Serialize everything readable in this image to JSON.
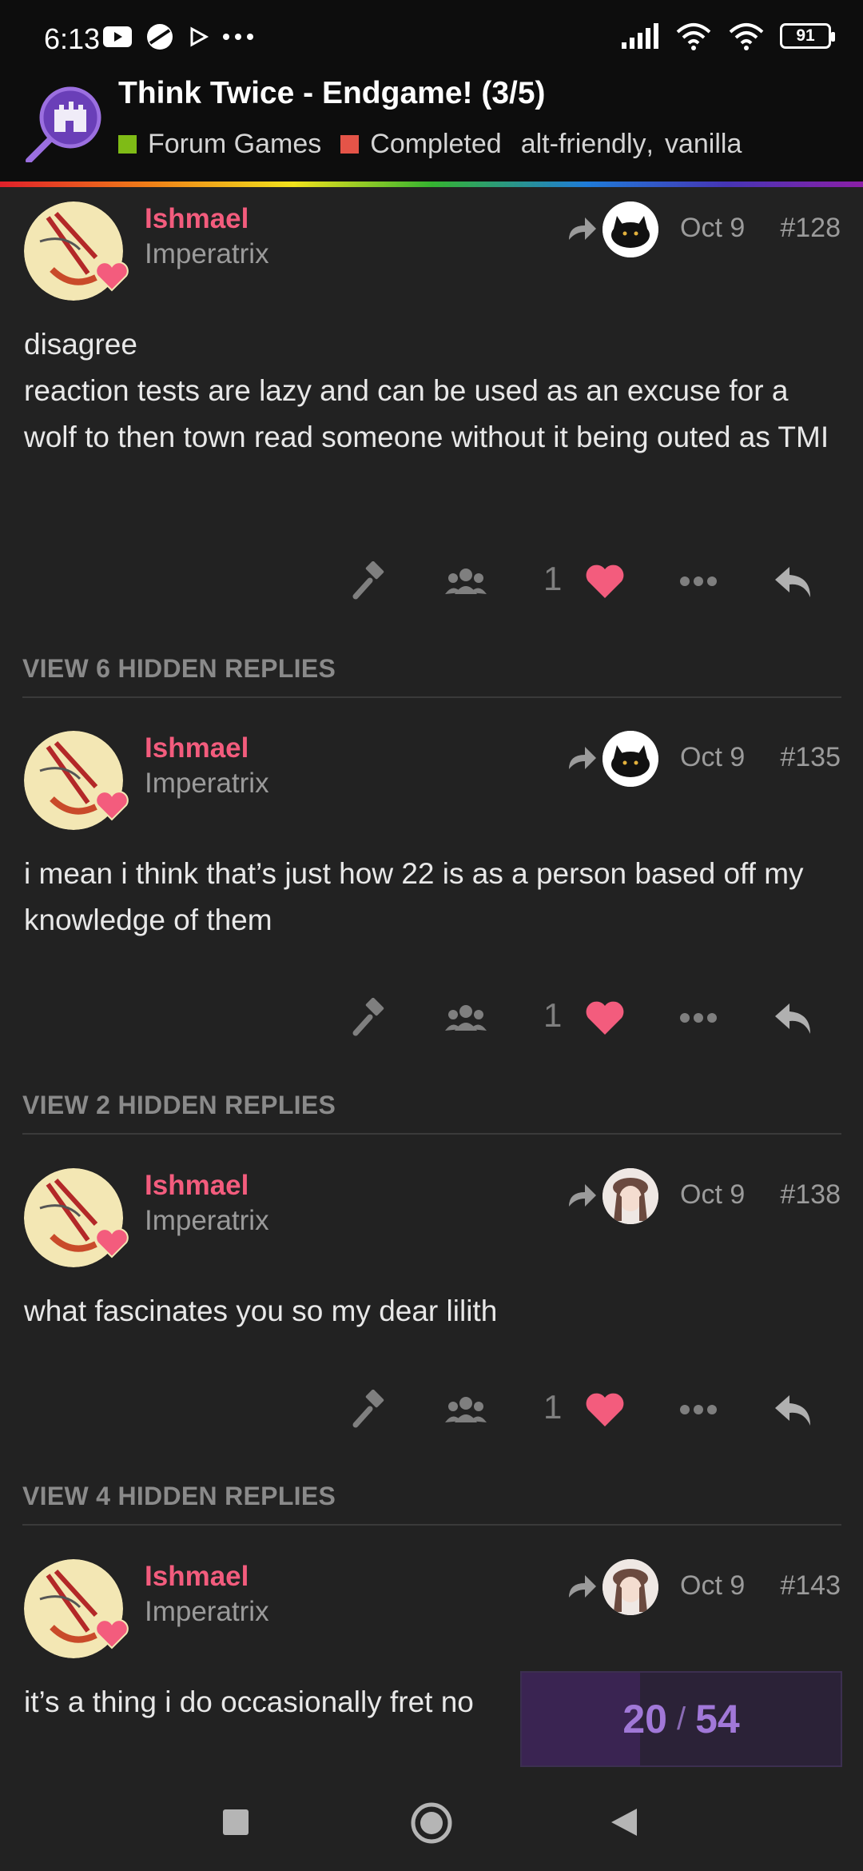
{
  "status_bar": {
    "time": "6:13",
    "battery": "91",
    "icons": [
      "youtube-icon",
      "app-icon",
      "play-store-icon",
      "more-dots-icon",
      "signal-icon",
      "wifi-icon",
      "wifi-2-icon",
      "battery-icon"
    ]
  },
  "topic": {
    "title": "Think Twice - Endgame! (3/5)",
    "category": {
      "name": "Forum Games",
      "color": "#7fbb16"
    },
    "status": {
      "name": "Completed",
      "color": "#e45448"
    },
    "tags": [
      "alt-friendly",
      "vanilla"
    ],
    "tag_separator": ","
  },
  "posts": [
    {
      "username": "Ishmael",
      "user_title": "Imperatrix",
      "date": "Oct 9",
      "number": "#128",
      "body": [
        "disagree",
        "reaction tests are lazy and can be used as an excuse for a wolf to then town read someone without it being outed as TMI"
      ],
      "likes": "1",
      "reply_to_avatar": "black-cat"
    },
    {
      "username": "Ishmael",
      "user_title": "Imperatrix",
      "date": "Oct 9",
      "number": "#135",
      "body": [
        "i mean i think that’s just how 22 is as a person based off my knowledge of them"
      ],
      "likes": "1",
      "reply_to_avatar": "black-cat"
    },
    {
      "username": "Ishmael",
      "user_title": "Imperatrix",
      "date": "Oct 9",
      "number": "#138",
      "body": [
        "what fascinates you so my dear lilith"
      ],
      "likes": "1",
      "reply_to_avatar": "anime-girl"
    },
    {
      "username": "Ishmael",
      "user_title": "Imperatrix",
      "date": "Oct 9",
      "number": "#143",
      "body": [
        "it’s a thing i do occasionally fret no"
      ],
      "reply_to_avatar": "anime-girl"
    }
  ],
  "hidden_replies": [
    "VIEW 6 HIDDEN REPLIES",
    "VIEW 2 HIDDEN REPLIES",
    "VIEW 4 HIDDEN REPLIES"
  ],
  "progress": {
    "current": "20",
    "separator": "/",
    "total": "54",
    "fraction": 0.37
  },
  "colors": {
    "accent_pink": "#f35c7d",
    "progress_purple": "#a178d8",
    "background": "#222222"
  }
}
